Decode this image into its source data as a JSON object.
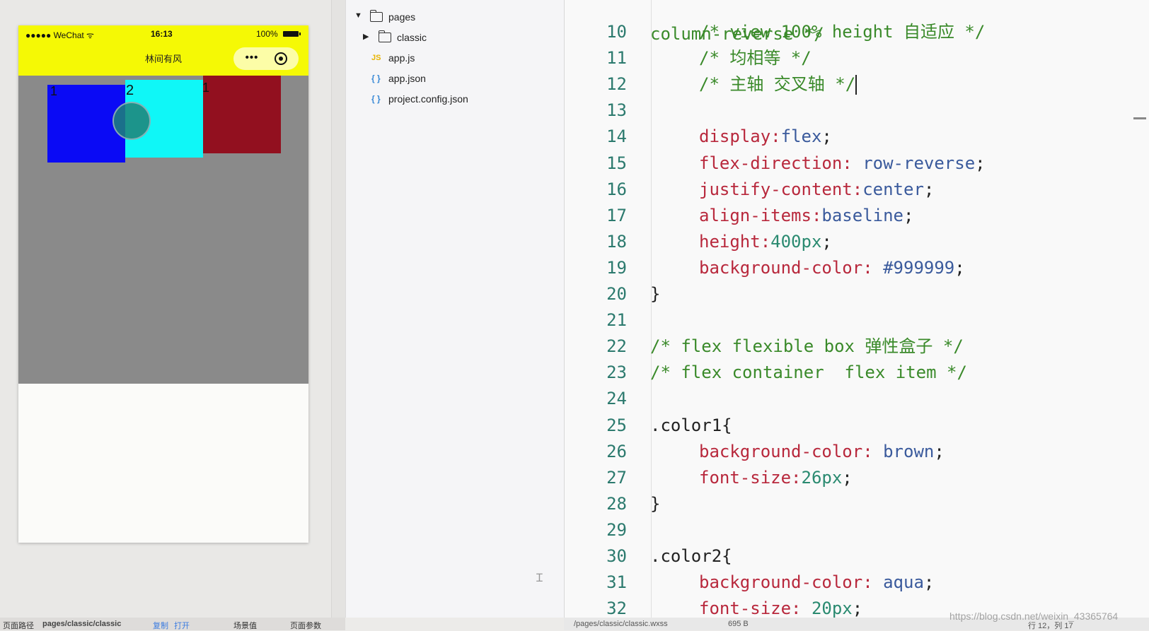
{
  "simulator": {
    "status": {
      "signal": "●●●●● WeChat ᯤ",
      "time": "16:13",
      "battery": "100%"
    },
    "nav_title": "林间有风",
    "capsule_more": "•••",
    "boxes": [
      {
        "label": "1",
        "color": "#0a0af5"
      },
      {
        "label": "2",
        "color": "#0ff7f7"
      },
      {
        "label": "1",
        "color": "#92101f"
      }
    ],
    "container_color": "#8a8a8a",
    "header_color": "#f5f905",
    "bottom_bar": {
      "label": "页面路径",
      "path": "pages/classic/classic",
      "copy": "复制",
      "open": "打开",
      "scene": "场景值",
      "params": "页面参数"
    }
  },
  "file_tree": {
    "items": [
      {
        "label": "pages",
        "type": "folder",
        "expanded": true
      },
      {
        "label": "classic",
        "type": "folder",
        "expanded": false
      },
      {
        "label": "app.js",
        "type": "js",
        "icon": "JS"
      },
      {
        "label": "app.json",
        "type": "json",
        "icon": "{ }"
      },
      {
        "label": "project.config.json",
        "type": "json",
        "icon": "{ }"
      }
    ]
  },
  "editor": {
    "line0": "column-reverse */",
    "lines": [
      {
        "n": "10",
        "text": "/* view 100% height 自适应 */"
      },
      {
        "n": "11",
        "text": "/* 均相等 */"
      },
      {
        "n": "12",
        "text": "/* 主轴 交叉轴 */"
      },
      {
        "n": "13",
        "text": ""
      },
      {
        "n": "14",
        "prop": "display",
        "sep": ":",
        "val": "flex",
        "end": ";"
      },
      {
        "n": "15",
        "prop": "flex-direction",
        "sep": ": ",
        "val": "row-reverse",
        "end": ";"
      },
      {
        "n": "16",
        "prop": "justify-content",
        "sep": ":",
        "val": "center",
        "end": ";"
      },
      {
        "n": "17",
        "prop": "align-items",
        "sep": ":",
        "val": "baseline",
        "end": ";"
      },
      {
        "n": "18",
        "prop": "height",
        "sep": ":",
        "val": "400px",
        "end": ";"
      },
      {
        "n": "19",
        "prop": "background-color",
        "sep": ": ",
        "val": "#999999",
        "end": ";"
      },
      {
        "n": "20",
        "text": "}"
      },
      {
        "n": "21",
        "text": ""
      },
      {
        "n": "22",
        "text": "/* flex flexible box 弹性盒子 */"
      },
      {
        "n": "23",
        "text": "/* flex container  flex item */"
      },
      {
        "n": "24",
        "text": ""
      },
      {
        "n": "25",
        "text": ".color1{"
      },
      {
        "n": "26",
        "prop": "background-color",
        "sep": ": ",
        "val": "brown",
        "end": ";"
      },
      {
        "n": "27",
        "prop": "font-size",
        "sep": ":",
        "val": "26px",
        "end": ";"
      },
      {
        "n": "28",
        "text": "}"
      },
      {
        "n": "29",
        "text": ""
      },
      {
        "n": "30",
        "text": ".color2{"
      },
      {
        "n": "31",
        "prop": "background-color",
        "sep": ": ",
        "val": "aqua",
        "end": ";"
      },
      {
        "n": "32",
        "prop": "font-size",
        "sep": ": ",
        "val": "20px",
        "end": ";"
      }
    ],
    "bottom": {
      "file": "/pages/classic/classic.wxss",
      "size": "695 B",
      "pos": "行 12，列 17"
    }
  },
  "watermark": "https://blog.csdn.net/weixin_43365764"
}
